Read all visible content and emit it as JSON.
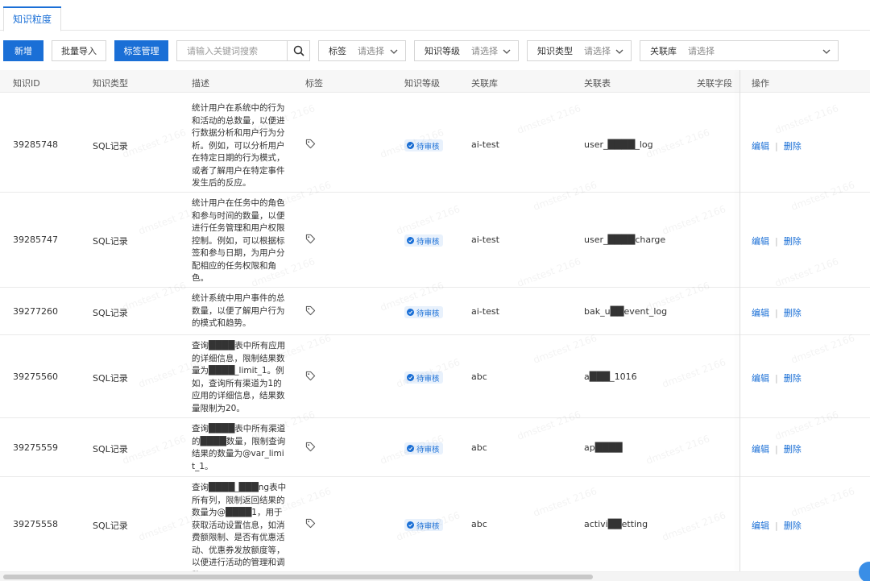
{
  "tabs": [
    {
      "label": "知识粒度",
      "active": true
    }
  ],
  "toolbar": {
    "add_label": "新增",
    "import_label": "批量导入",
    "tag_manage_label": "标签管理",
    "search_placeholder": "请输入关键词搜索",
    "filters": [
      {
        "label": "标签",
        "value": "请选择"
      },
      {
        "label": "知识等级",
        "value": "请选择"
      },
      {
        "label": "知识类型",
        "value": "请选择"
      },
      {
        "label": "关联库",
        "value": "请选择"
      }
    ]
  },
  "columns": [
    "知识ID",
    "知识类型",
    "描述",
    "标签",
    "知识等级",
    "关联库",
    "关联表",
    "关联字段",
    "操作"
  ],
  "status_label": "待审核",
  "ops": {
    "edit": "编辑",
    "delete": "删除"
  },
  "rows": [
    {
      "id": "39285748",
      "type": "SQL记录",
      "desc": "统计用户在系统中的行为和活动的总数量，以便进行数据分析和用户行为分析。例如，可以分析用户在特定日期的行为模式，或者了解用户在特定事件发生后的反应。",
      "db": "ai-test",
      "table": "user_████_log"
    },
    {
      "id": "39285747",
      "type": "SQL记录",
      "desc": "统计用户在任务中的角色和参与时间的数量，以便进行任务管理和用户权限控制。例如，可以根据标签和参与日期，为用户分配相应的任务权限和角色。",
      "db": "ai-test",
      "table": "user_████charge"
    },
    {
      "id": "39277260",
      "type": "SQL记录",
      "desc": "统计系统中用户事件的总数量，以便了解用户行为的模式和趋势。",
      "db": "ai-test",
      "table": "bak_u██event_log"
    },
    {
      "id": "39275560",
      "type": "SQL记录",
      "desc": "查询████表中所有应用的详细信息，限制结果数量为████_limit_1。例如，查询所有渠道为1的应用的详细信息，结果数量限制为20。",
      "db": "abc",
      "table": "a███_1016"
    },
    {
      "id": "39275559",
      "type": "SQL记录",
      "desc": "查询████表中所有渠道的████数量，限制查询结果的数量为@var_limit_1。",
      "db": "abc",
      "table": "ap████"
    },
    {
      "id": "39275558",
      "type": "SQL记录",
      "desc": "查询████_███ng表中所有列，限制返回结果的数量为@████1，用于获取活动设置信息，如消费额限制、是否有优惠活动、优惠券发放额度等，以便进行活动的管理和调整。",
      "db": "abc",
      "table": "activi██etting"
    }
  ],
  "watermark": "dmstest 2166",
  "colors": {
    "primary": "#1a6fd6",
    "badge_bg": "#e8f1fc"
  }
}
